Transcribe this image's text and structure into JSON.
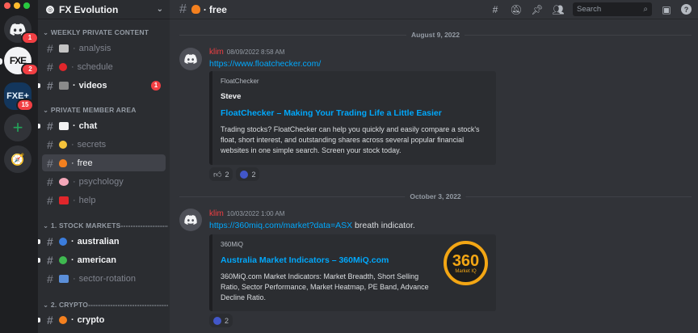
{
  "window": {
    "traffic_colors": [
      "#ff5f57",
      "#febc2e",
      "#28c840"
    ]
  },
  "servers": [
    {
      "name": "home",
      "badge": "1"
    },
    {
      "name": "FXE",
      "label": "FXE",
      "badge": "2"
    },
    {
      "name": "FXE+",
      "label": "FXE+",
      "badge": "15"
    },
    {
      "name": "add-server",
      "label": "+"
    },
    {
      "name": "explore",
      "label": "🧭"
    }
  ],
  "sidebar": {
    "server_name": "FX Evolution",
    "categories": [
      {
        "label": "WEEKLY PRIVATE CONTENT"
      },
      {
        "label": "PRIVATE MEMBER AREA"
      },
      {
        "label": "1. STOCK MARKETS----------------------------"
      },
      {
        "label": "2. CRYPTO-------------------------------------"
      }
    ],
    "channels": [
      {
        "name": "analysis",
        "emoji": "📰"
      },
      {
        "name": "schedule",
        "emoji": "🔴"
      },
      {
        "name": "videos",
        "emoji": "📽",
        "badge": "1"
      },
      {
        "name": "chat",
        "emoji": "📈"
      },
      {
        "name": "secrets",
        "emoji": "🤫"
      },
      {
        "name": "free",
        "emoji": "🔥"
      },
      {
        "name": "psychology",
        "emoji": "🧠"
      },
      {
        "name": "help",
        "emoji": "🆘"
      },
      {
        "name": "australian",
        "emoji": "🔵"
      },
      {
        "name": "american",
        "emoji": "🟢"
      },
      {
        "name": "sector-rotation",
        "emoji": "🔄"
      },
      {
        "name": "crypto",
        "emoji": "🟠"
      }
    ]
  },
  "header": {
    "channel": "free",
    "emoji": "🔥",
    "search_placeholder": "Search"
  },
  "messages": [
    {
      "date": "August 9, 2022",
      "author": "klim",
      "timestamp": "08/09/2022 8:58 AM",
      "link": "https://www.floatchecker.com/",
      "embed": {
        "provider": "FloatChecker",
        "author": "Steve",
        "title": "FloatChecker – Making Your Trading Life a Little Easier",
        "description_lines": [
          "Trading stocks? FloatChecker can help you quickly and easily compare a stock's",
          "float, short interest, and outstanding shares across several popular financial",
          "websites in one simple search. Screen your stock today."
        ]
      },
      "reactions": [
        {
          "emoji": "👍",
          "count": "2"
        },
        {
          "emoji": "custom",
          "count": "2"
        }
      ]
    },
    {
      "date": "October 3, 2022",
      "author": "klim",
      "timestamp": "10/03/2022 1:00 AM",
      "link": "https://360miq.com/market?data=ASX",
      "text_after_link": " breath indicator.",
      "embed": {
        "provider": "360MiQ",
        "title": "Australia Market Indicators – 360MiQ.com",
        "description_lines": [
          "360MiQ.com Market Indicators: Market Breadth, Short Selling",
          "Ratio, Sector Performance, Market Heatmap, PE Band, Advance",
          "Decline Ratio."
        ],
        "thumbnail": {
          "number": "360",
          "caption": "Market IQ"
        }
      },
      "reactions": [
        {
          "emoji": "custom",
          "count": "2"
        }
      ]
    }
  ]
}
